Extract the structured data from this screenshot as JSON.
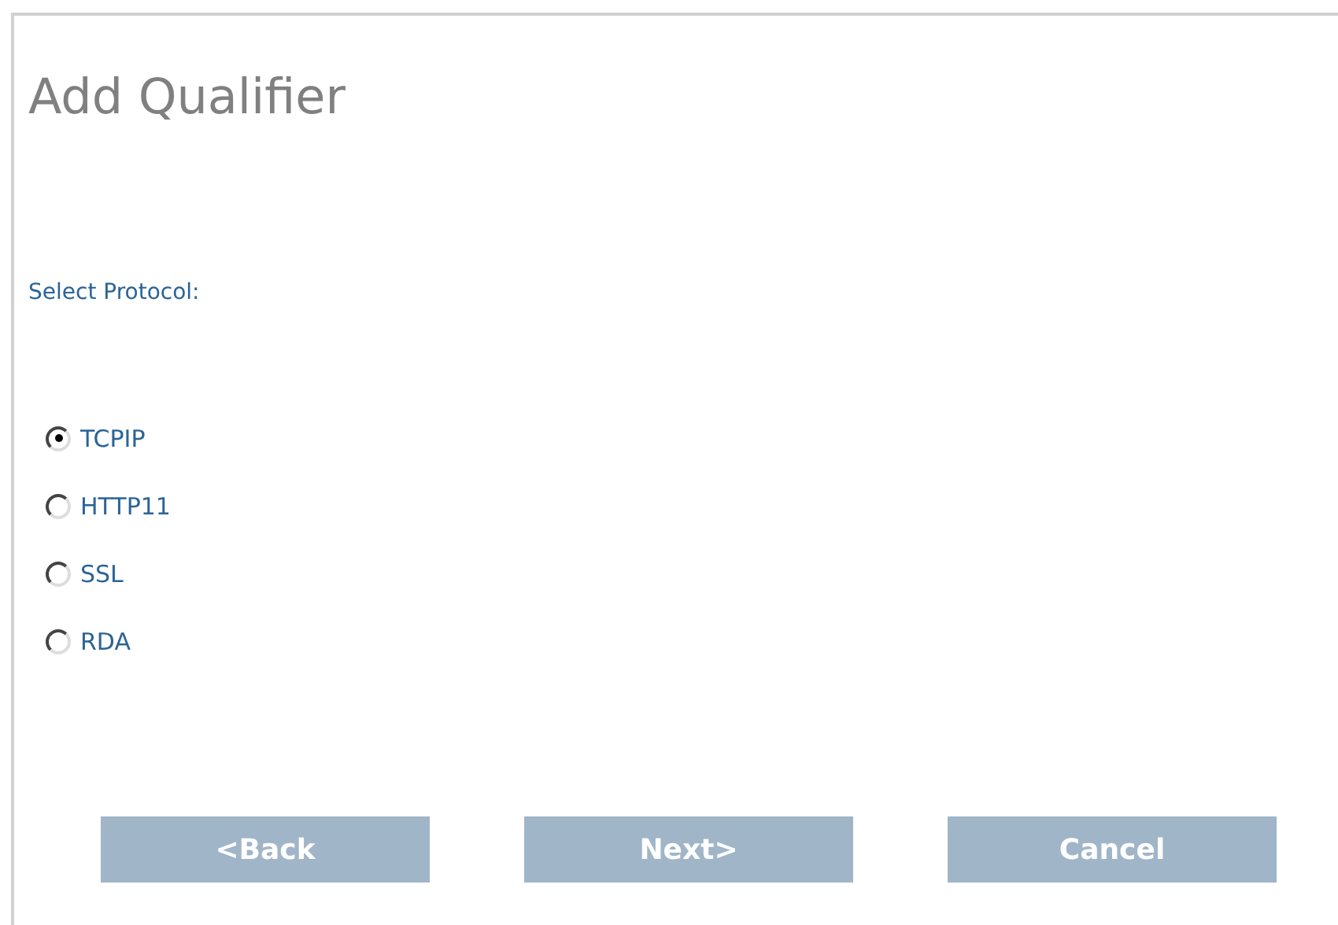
{
  "title": "Add Qualifier",
  "prompt": "Select Protocol:",
  "protocols": [
    {
      "label": "TCPIP",
      "selected": true
    },
    {
      "label": "HTTP11",
      "selected": false
    },
    {
      "label": "SSL",
      "selected": false
    },
    {
      "label": "RDA",
      "selected": false
    }
  ],
  "buttons": [
    "<Back",
    "Next>",
    "Cancel"
  ]
}
